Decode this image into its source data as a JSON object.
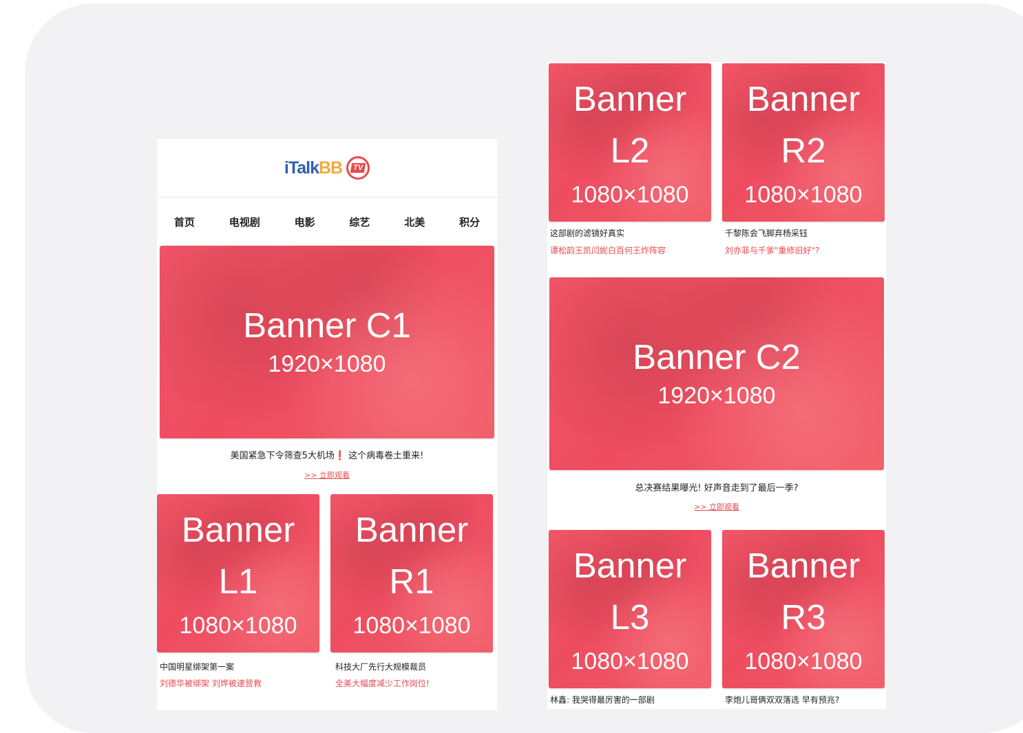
{
  "left_phone": {
    "logo": {
      "part1": "iTalk",
      "part2": "BB",
      "badge": "TV"
    },
    "nav": [
      "首页",
      "电视剧",
      "电影",
      "综艺",
      "北美",
      "积分"
    ],
    "banner_c1": {
      "name": "Banner C1",
      "size": "1920×1080"
    },
    "c1_caption": "美国紧急下令筛查5大机场❗️ 这个病毒卷土重来!",
    "c1_link": ">> 立即观看",
    "banner_l1": {
      "line1": "Banner",
      "line2": "L1",
      "size": "1080×1080"
    },
    "banner_r1": {
      "line1": "Banner",
      "line2": "R1",
      "size": "1080×1080"
    },
    "l1_title": "中国明星绑架第一案",
    "l1_desc": "刘德华被绑架 刘烨被逮营救",
    "r1_title": "科技大厂先行大规模裁员",
    "r1_desc": "全美大幅度减少工作岗位!"
  },
  "right_phone": {
    "banner_l2": {
      "line1": "Banner",
      "line2": "L2",
      "size": "1080×1080"
    },
    "banner_r2": {
      "line1": "Banner",
      "line2": "R2",
      "size": "1080×1080"
    },
    "l2_title": "这部剧的滤镜好真实",
    "l2_desc": "谭松韵王凯闫妮白百何王炸阵容",
    "r2_title": "千黎陈会飞脚弃杨采钰",
    "r2_desc": "刘亦菲与千爹\"重修旧好\"?",
    "banner_c2": {
      "name": "Banner C2",
      "size": "1920×1080"
    },
    "c2_caption": "总决赛结果曝光! 好声音走到了最后一季?",
    "c2_link": ">> 立即观看",
    "banner_l3": {
      "line1": "Banner",
      "line2": "L3",
      "size": "1080×1080"
    },
    "banner_r3": {
      "line1": "Banner",
      "line2": "R3",
      "size": "1080×1080"
    },
    "l3_title": "林鑫: 我哭得最厉害的一部剧",
    "r3_title": "李炮儿哥俩双双落选 早有预兆?"
  },
  "colors": {
    "banner": "#ee4d60",
    "accent": "#e8494f",
    "logo_blue": "#2f5fb3",
    "logo_orange": "#f0a93b"
  }
}
